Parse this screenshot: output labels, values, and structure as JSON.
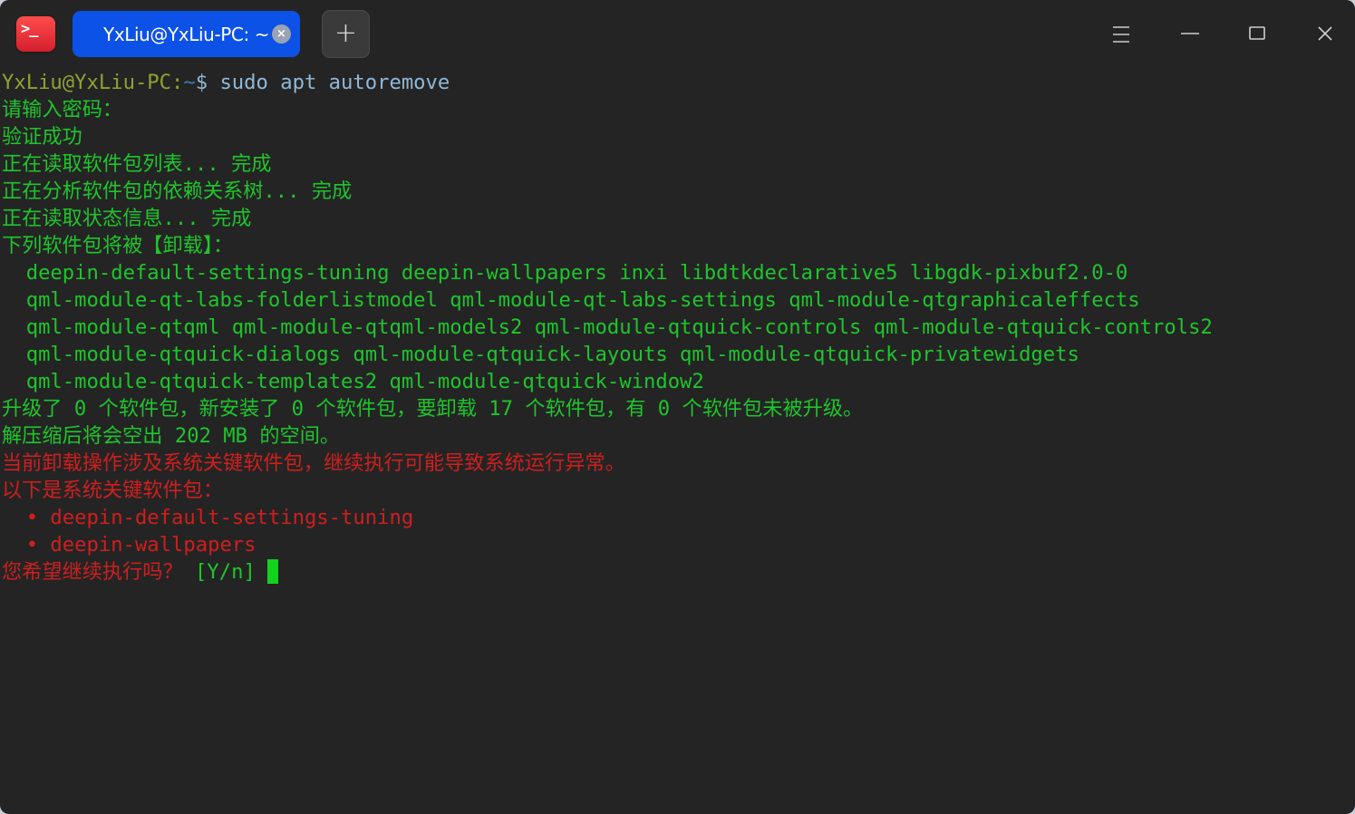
{
  "window": {
    "tab_title": "YxLiu@YxLiu-PC: ~",
    "tab_close_glyph": "×",
    "new_tab_glyph": "+",
    "app_icon_glyph": ">_"
  },
  "icons": {
    "app": "terminal-app-icon",
    "tab_close": "close-icon",
    "new_tab": "plus-icon",
    "menu": "hamburger-menu-icon",
    "minimize": "minimize-icon",
    "maximize": "maximize-icon",
    "close": "close-icon"
  },
  "colors": {
    "background": "#242424",
    "tab_active": "#0d52e6",
    "output_green": "#1fc52c",
    "output_red": "#cf1f1f",
    "prompt_user": "#8fa233",
    "cursor": "#13d21d"
  },
  "terminal": {
    "prompt_user": "YxLiu@YxLiu-PC",
    "prompt_sep": ":",
    "prompt_path": "~",
    "prompt_symbol": "$ ",
    "command": "sudo apt autoremove",
    "lines": [
      "请输入密码：",
      "验证成功",
      "正在读取软件包列表... 完成",
      "正在分析软件包的依赖关系树... 完成",
      "正在读取状态信息... 完成",
      "下列软件包将被【卸载】：",
      "  deepin-default-settings-tuning deepin-wallpapers inxi libdtkdeclarative5 libgdk-pixbuf2.0-0",
      "  qml-module-qt-labs-folderlistmodel qml-module-qt-labs-settings qml-module-qtgraphicaleffects",
      "  qml-module-qtqml qml-module-qtqml-models2 qml-module-qtquick-controls qml-module-qtquick-controls2",
      "  qml-module-qtquick-dialogs qml-module-qtquick-layouts qml-module-qtquick-privatewidgets",
      "  qml-module-qtquick-templates2 qml-module-qtquick-window2",
      "升级了 0 个软件包，新安装了 0 个软件包，要卸载 17 个软件包，有 0 个软件包未被升级。",
      "解压缩后将会空出 202 MB 的空间。"
    ],
    "warning_lines": [
      "当前卸载操作涉及系统关键软件包，继续执行可能导致系统运行异常。",
      "以下是系统关键软件包：",
      "  • deepin-default-settings-tuning",
      "  • deepin-wallpapers"
    ],
    "confirm_question": "您希望继续执行吗？",
    "confirm_options": " [Y/n] "
  }
}
